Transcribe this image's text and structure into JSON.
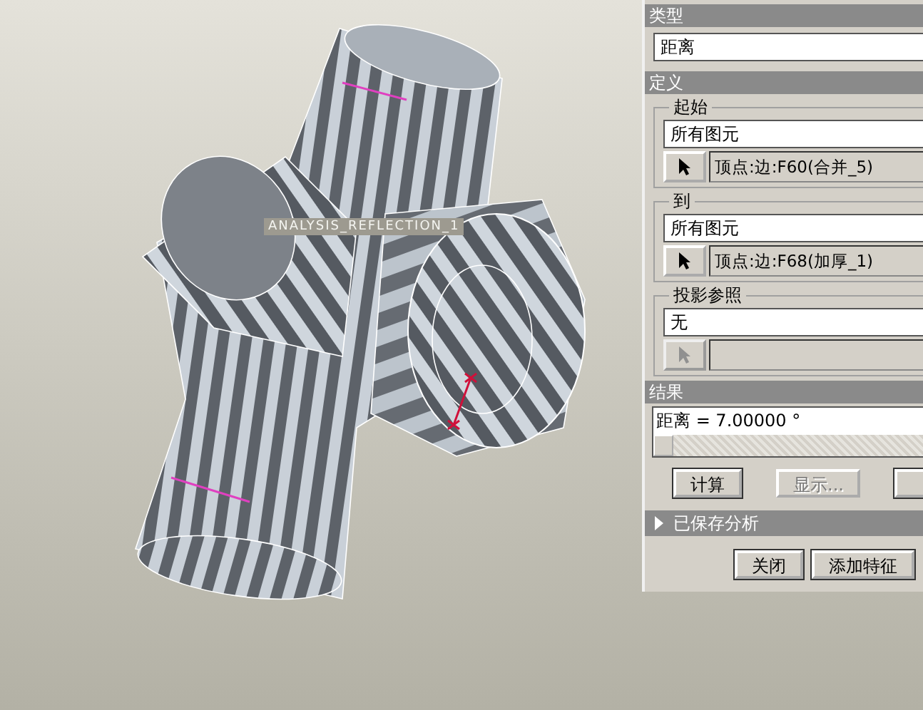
{
  "view": {
    "label": "ANALYSIS_REFLECTION_1"
  },
  "panel": {
    "type_section": {
      "title": "类型",
      "value": "距离"
    },
    "definition": {
      "title": "定义",
      "groups": [
        {
          "title": "起始",
          "filter": "所有图元",
          "selection": "顶点:边:F60(合并_5)",
          "disabled": false
        },
        {
          "title": "到",
          "filter": "所有图元",
          "selection": "顶点:边:F68(加厚_1)",
          "disabled": false
        },
        {
          "title": "投影参照",
          "filter": "无",
          "disabled": true
        }
      ]
    },
    "result": {
      "title": "结果",
      "text": "距离 = 7.00000 °"
    },
    "actions": [
      {
        "label": "计算",
        "disabled": false
      },
      {
        "label": "显示...",
        "disabled": true
      }
    ],
    "saved": {
      "title": "已保存分析",
      "expanded": false
    },
    "footer_buttons": [
      "关闭",
      "添加特征"
    ]
  }
}
